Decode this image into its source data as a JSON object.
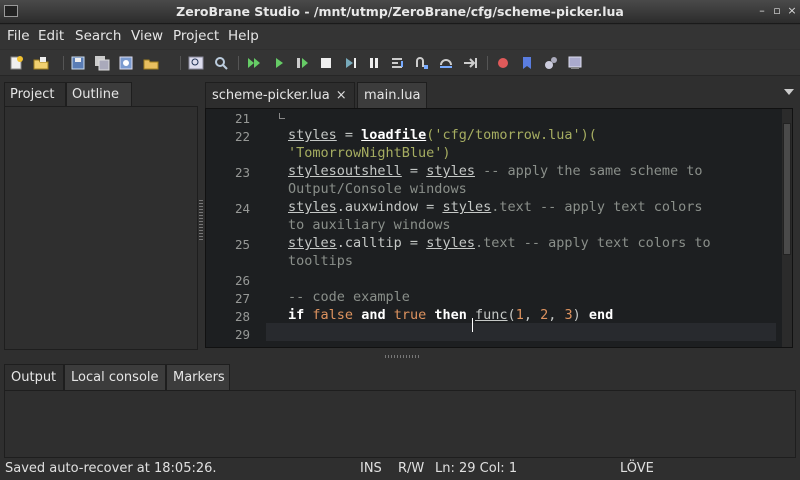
{
  "window": {
    "title": "ZeroBrane Studio - /mnt/utmp/ZeroBrane/cfg/scheme-picker.lua",
    "controls": [
      "–",
      "▫",
      "×"
    ]
  },
  "menu": [
    "File",
    "Edit",
    "Search",
    "View",
    "Project",
    "Help"
  ],
  "toolbar": {
    "icons": [
      "new-file-icon",
      "open-file-icon",
      "save-icon",
      "save-all-icon",
      "project-directory-icon",
      "find-icon",
      "replace-icon",
      "run-icon",
      "start-debug-icon",
      "compile-icon",
      "stop-icon",
      "step-into-icon",
      "break-icon",
      "step-over-icon",
      "step-out-icon",
      "run-to-cursor-icon",
      "toggle-breakpoint-icon",
      "bookmark-icon",
      "settings-icon",
      "monitor-icon"
    ]
  },
  "left_panel": {
    "tabs": [
      "Project",
      "Outline"
    ],
    "active": "Project"
  },
  "editor": {
    "tabs": [
      {
        "label": "scheme-picker.lua",
        "close": "×"
      },
      {
        "label": "main.lua"
      }
    ],
    "lines": [
      {
        "n": "21"
      },
      {
        "n": "22",
        "a": "styles",
        "b": " = ",
        "c": "loadfile",
        "d": "('cfg/tomorrow.lua')(",
        "wrap": "'TomorrowNightBlue')"
      },
      {
        "n": "23",
        "a": "stylesoutshell",
        "b": " = ",
        "c": "styles",
        "d": " -- apply the same scheme to",
        "wrap": "Output/Console windows"
      },
      {
        "n": "24",
        "a": "styles",
        "b": ".auxwindow = ",
        "c": "styles",
        "d": ".text -- apply text colors",
        "wrap": "to auxiliary windows"
      },
      {
        "n": "25",
        "a": "styles",
        "b": ".calltip = ",
        "c": "styles",
        "d": ".text -- apply text colors to",
        "wrap": "tooltips"
      },
      {
        "n": "26"
      },
      {
        "n": "27",
        "comment": "-- code example"
      },
      {
        "n": "28",
        "k1": "if",
        "f": "false",
        "k2": "and",
        "t": "true",
        "k3": "then",
        "fn": "func",
        "p1": "(",
        "n1": "1",
        "c1": ", ",
        "n2": "2",
        "c2": ", ",
        "n3": "3",
        "p2": ")",
        "k4": "end"
      },
      {
        "n": "29"
      }
    ]
  },
  "bottom_panel": {
    "tabs": [
      "Output",
      "Local console",
      "Markers"
    ],
    "active": "Output"
  },
  "status": {
    "message": "Saved auto-recover at 18:05:26.",
    "mode": "INS",
    "access": "R/W",
    "position": "Ln: 29 Col: 1",
    "interpreter": "LÖVE"
  }
}
